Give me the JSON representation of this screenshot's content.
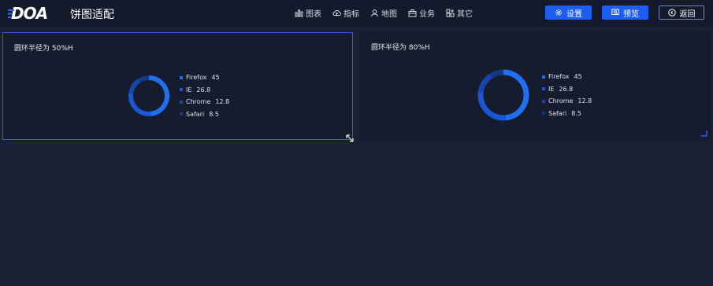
{
  "header": {
    "logo_text": "DOA",
    "page_title": "饼图适配",
    "nav": [
      {
        "label": "图表",
        "icon": "bar-chart-icon"
      },
      {
        "label": "指标",
        "icon": "cloud-upload-icon"
      },
      {
        "label": "地图",
        "icon": "map-pin-icon"
      },
      {
        "label": "业务",
        "icon": "briefcase-icon"
      },
      {
        "label": "其它",
        "icon": "grid-plus-icon"
      }
    ],
    "buttons": {
      "settings": "设置",
      "preview": "预览",
      "back": "返回"
    }
  },
  "colors": {
    "accent": "#1d5ef0",
    "series": [
      "#1f6ff0",
      "#1957d6",
      "#1546ad",
      "#123985"
    ]
  },
  "panels": [
    {
      "title": "圆环半径为 50%H"
    },
    {
      "title": "圆环半径为 80%H"
    }
  ],
  "chart_data": [
    {
      "type": "pie",
      "title": "圆环半径为 50%H",
      "categories": [
        "Firefox",
        "IE",
        "Chrome",
        "Safari"
      ],
      "values": [
        45,
        26.8,
        12.8,
        8.5
      ],
      "value_labels": [
        "45",
        "26.8",
        "12.8",
        "8.5"
      ],
      "legend": "right"
    },
    {
      "type": "pie",
      "title": "圆环半径为 80%H",
      "categories": [
        "Firefox",
        "IE",
        "Chrome",
        "Safari"
      ],
      "values": [
        45,
        26.8,
        12.8,
        8.5
      ],
      "value_labels": [
        "45",
        "26.8",
        "12.8",
        "8.5"
      ],
      "legend": "right"
    }
  ]
}
